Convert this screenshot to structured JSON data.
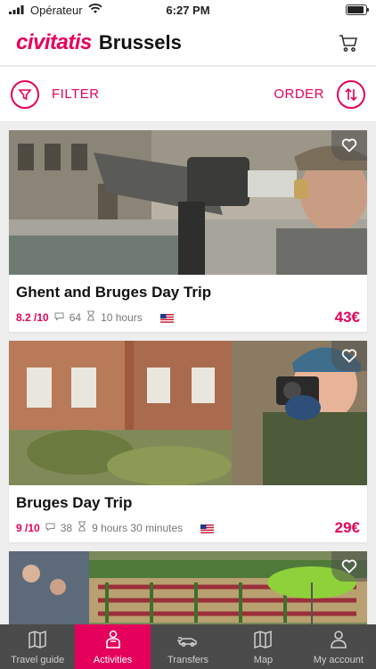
{
  "status": {
    "carrier": "Opérateur",
    "time": "6:27 PM"
  },
  "header": {
    "brand": "civitatis",
    "city": "Brussels"
  },
  "filter_bar": {
    "filter_label": "FILTER",
    "order_label": "ORDER"
  },
  "cards": [
    {
      "title": "Ghent and Bruges Day Trip",
      "rating": "8.2 /10",
      "reviews": "64",
      "duration": "10 hours",
      "price": "43€"
    },
    {
      "title": "Bruges Day Trip",
      "rating": "9 /10",
      "reviews": "38",
      "duration": "9 hours 30 minutes",
      "price": "29€"
    }
  ],
  "tabs": [
    {
      "label": "Travel guide",
      "icon": "map-book-icon"
    },
    {
      "label": "Activities",
      "icon": "person-icon",
      "active": true
    },
    {
      "label": "Transfers",
      "icon": "car-icon"
    },
    {
      "label": "Map",
      "icon": "map-icon"
    },
    {
      "label": "My account",
      "icon": "account-icon"
    }
  ],
  "colors": {
    "accent": "#e5005b",
    "tabbar": "#4b4b4b"
  }
}
